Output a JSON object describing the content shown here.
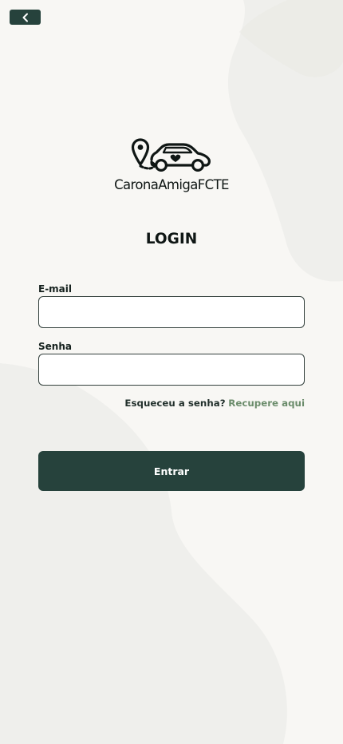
{
  "brand": {
    "name": "CaronaAmigaFCTE",
    "colors": {
      "primary": "#26423c",
      "accent": "#6b8c6b",
      "background": "#f8f7f4"
    }
  },
  "nav": {
    "back_icon": "chevron-left-icon"
  },
  "logo": {
    "icon": "car-with-location-pin-icon"
  },
  "page": {
    "title": "LOGIN"
  },
  "form": {
    "email": {
      "label": "E-mail",
      "value": "",
      "placeholder": ""
    },
    "password": {
      "label": "Senha",
      "value": "",
      "placeholder": ""
    },
    "forgot": {
      "text": "Esqueceu a senha?",
      "link": "Recupere aqui"
    },
    "submit_label": "Entrar"
  }
}
